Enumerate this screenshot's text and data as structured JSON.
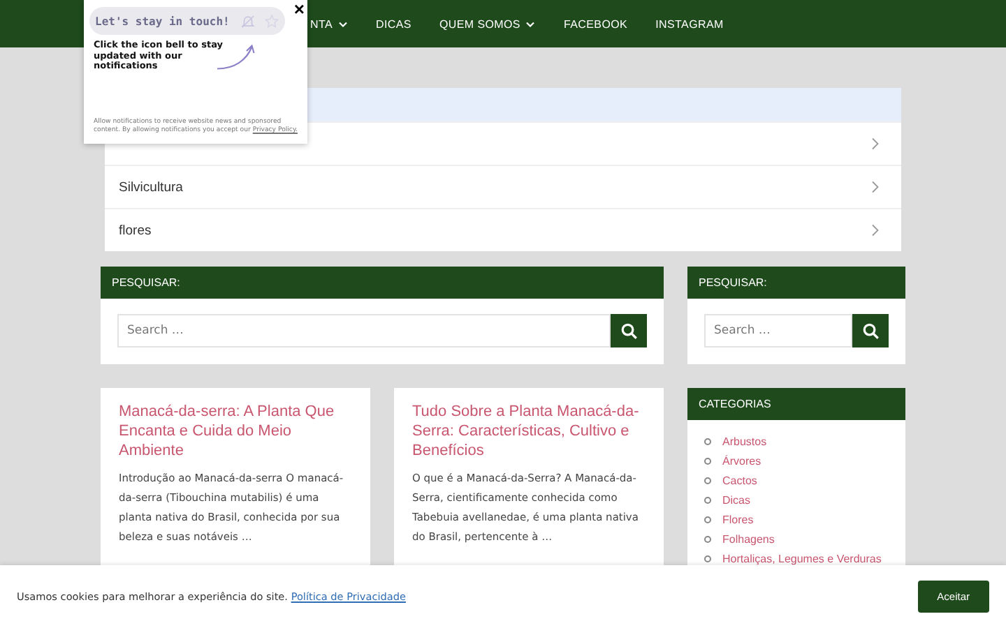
{
  "nav": {
    "items": [
      {
        "label": "NTA",
        "dropdown": true
      },
      {
        "label": "DICAS",
        "dropdown": false
      },
      {
        "label": "QUEM SOMOS",
        "dropdown": true
      },
      {
        "label": "FACEBOOK",
        "dropdown": false
      },
      {
        "label": "INSTAGRAM",
        "dropdown": false
      }
    ]
  },
  "popup": {
    "title": "Let's stay in touch!",
    "message": "Click the icon bell to stay updated with our notifications",
    "close": "×",
    "legal": "Allow notifications to receive website news and sponsored content. By allowing notifications you accept our",
    "link": "Privacy Policy."
  },
  "category_list": {
    "items": [
      "Silvicultura",
      "flores"
    ]
  },
  "search_widgets": [
    {
      "title": "PESQUISAR:",
      "placeholder": "Search …"
    },
    {
      "title": "PESQUISAR:",
      "placeholder": "Search …"
    }
  ],
  "posts": [
    {
      "title": "Manacá-da-serra: A Planta Que Encanta e Cuida do Meio Ambiente",
      "excerpt": "Introdução ao Manacá-da-serra O manacá-da-serra (Tibouchina mutabilis) é uma planta nativa do Brasil, conhecida por sua beleza e suas notáveis …"
    },
    {
      "title": "Tudo Sobre a Planta Manacá-da-Serra: Características, Cultivo e Benefícios",
      "excerpt": "O que é a Manacá-da-Serra? A Manacá-da-Serra, cientificamente conhecida como Tabebuia avellanedae, é uma planta nativa do Brasil, pertencente à …"
    }
  ],
  "categories": {
    "title": "CATEGORIAS",
    "items": [
      "Arbustos",
      "Árvores",
      "Cactos",
      "Dicas",
      "Flores",
      "Folhagens",
      "Hortaliças, Legumes e Verduras"
    ]
  },
  "cookie_bar": {
    "text": "Usamos cookies para melhorar a experiência do site.",
    "link": "Política de Privacidade",
    "button": "Aceitar"
  }
}
